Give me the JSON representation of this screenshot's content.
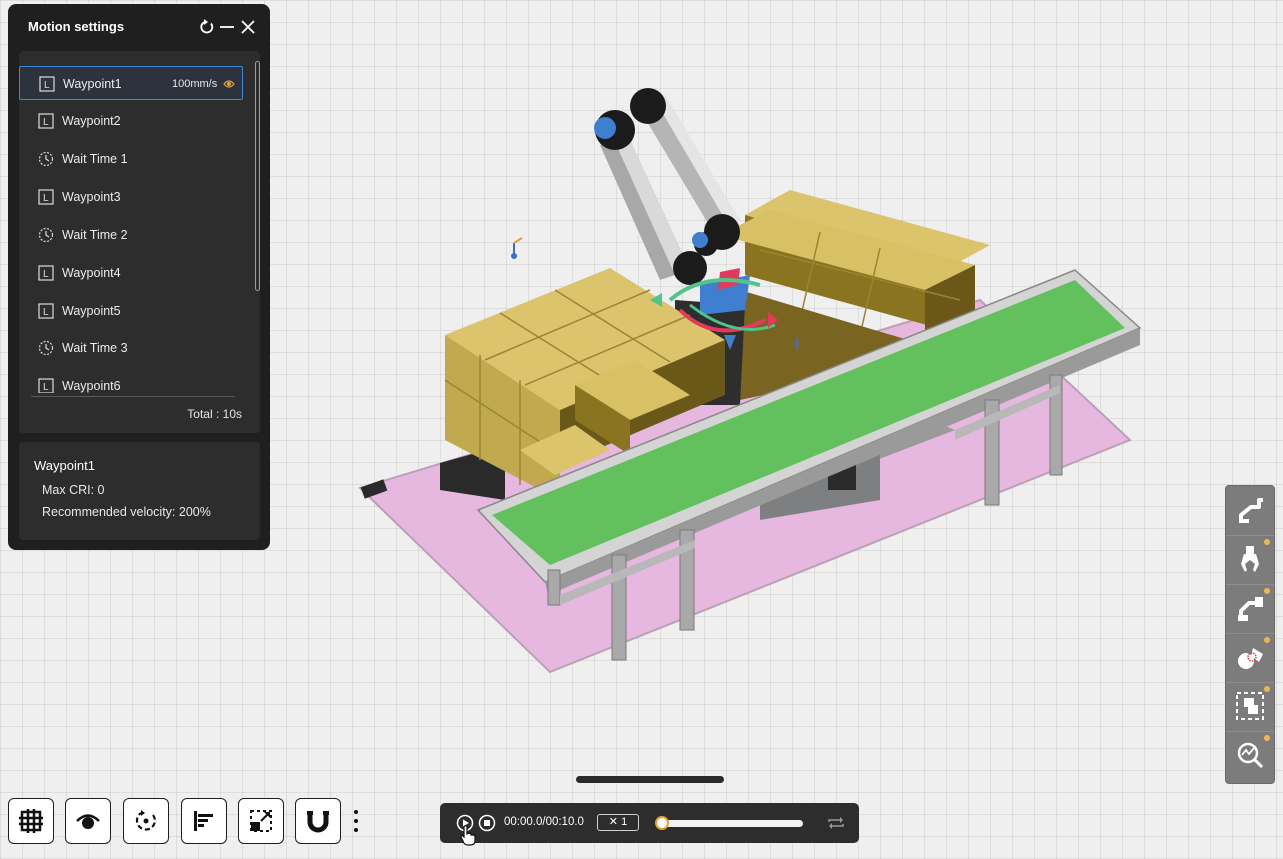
{
  "panel": {
    "title": "Motion settings",
    "waypoints": [
      {
        "type": "linear",
        "label": "Waypoint1",
        "speed": "100mm/s",
        "selected": true
      },
      {
        "type": "linear",
        "label": "Waypoint2"
      },
      {
        "type": "wait",
        "label": "Wait Time 1"
      },
      {
        "type": "linear",
        "label": "Waypoint3"
      },
      {
        "type": "wait",
        "label": "Wait Time 2"
      },
      {
        "type": "linear",
        "label": "Waypoint4"
      },
      {
        "type": "linear",
        "label": "Waypoint5"
      },
      {
        "type": "wait",
        "label": "Wait Time 3"
      },
      {
        "type": "linear",
        "label": "Waypoint6"
      }
    ],
    "linear_icon_text": "L",
    "total": "Total : 10s"
  },
  "info": {
    "title": "Waypoint1",
    "max_cri": "Max CRI: 0",
    "recommended_velocity": "Recommended velocity: 200%"
  },
  "playback": {
    "time": "00:00.0/00:10.0",
    "speed": "✕ 1",
    "progress": 0
  },
  "right_toolbar": [
    {
      "icon": "robot-arm-icon",
      "badge": false
    },
    {
      "icon": "gripper-icon",
      "badge": true
    },
    {
      "icon": "robot-pose-icon",
      "badge": true
    },
    {
      "icon": "collision-icon",
      "badge": true
    },
    {
      "icon": "layout-icon",
      "badge": true
    },
    {
      "icon": "analysis-icon",
      "badge": true
    }
  ],
  "bottom_toolbar": [
    "grid-icon",
    "view-icon",
    "rotate-icon",
    "align-icon",
    "scale-icon",
    "magnet-icon"
  ],
  "colors": {
    "accent": "#3d86d8",
    "badge": "#f0b64d",
    "panel_bg": "#1f1f1f",
    "box": "#d8c36a",
    "conveyor_belt": "#62c05d",
    "floor_zone": "#e6b8e0"
  }
}
